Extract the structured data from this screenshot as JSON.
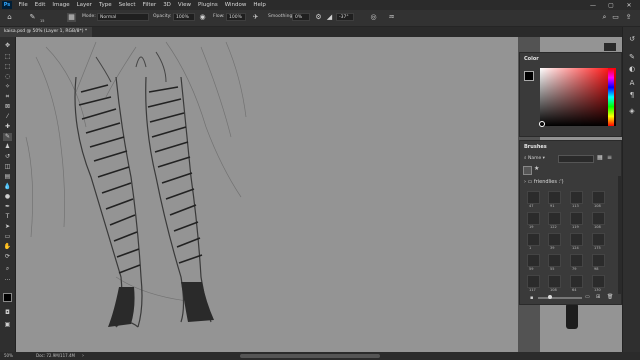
{
  "menu": {
    "app_logo": "Ps",
    "items": [
      "File",
      "Edit",
      "Image",
      "Layer",
      "Type",
      "Select",
      "Filter",
      "3D",
      "View",
      "Plugins",
      "Window",
      "Help"
    ],
    "window_controls": [
      "—",
      "▢",
      "✕"
    ]
  },
  "options": {
    "mode_label": "Mode:",
    "mode_value": "Normal",
    "opacity_label": "Opacity:",
    "opacity_value": "100%",
    "flow_label": "Flow:",
    "flow_value": "100%",
    "smoothing_label": "Smoothing:",
    "smoothing_value": "0%",
    "angle_value": "-37°",
    "brush_size": "15"
  },
  "document": {
    "tab_label": "kaisa.psd @ 50% (Layer 1, RGB/8*) *"
  },
  "color_panel": {
    "title": "Color",
    "hue_color": "#ff0000"
  },
  "brushes_panel": {
    "title": "Brushes",
    "name_label": "Name",
    "folder_name": "friendlies :')",
    "brush_sizes": [
      "47",
      "91",
      "113",
      "108",
      "19",
      "122",
      "119",
      "108",
      "1",
      "39",
      "124",
      "175",
      "59",
      "55",
      "79",
      "98",
      "117",
      "108",
      "64",
      "130"
    ]
  },
  "status": {
    "zoom": "50%",
    "doc_info": "Doc: 72.9M/117.4M"
  }
}
